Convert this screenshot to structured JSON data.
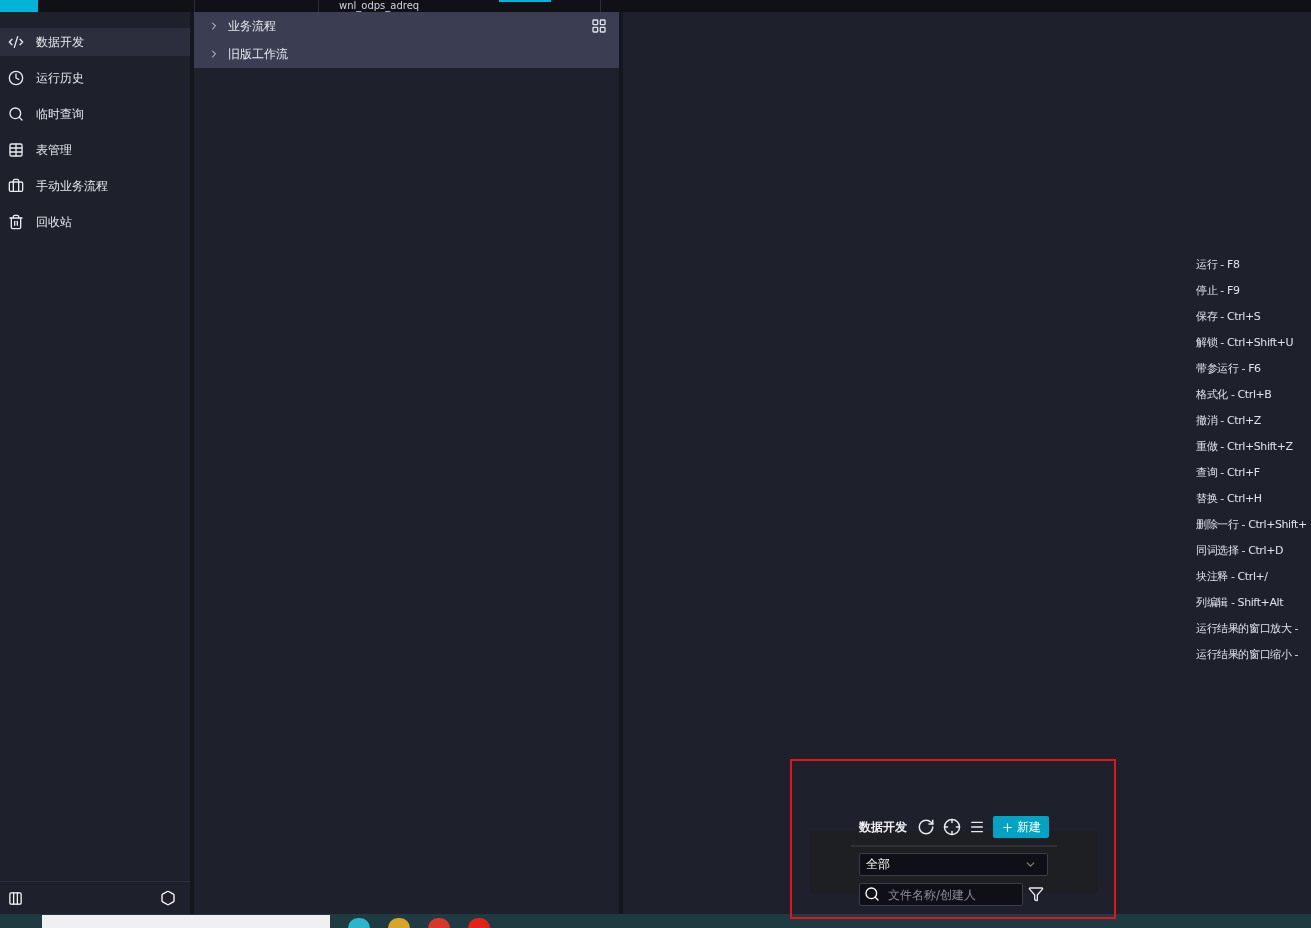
{
  "top_bar": {
    "tab": "wnl_odps_adreq"
  },
  "sidebar": {
    "items": [
      {
        "label": "数据开发",
        "selected": true
      },
      {
        "label": "运行历史",
        "selected": false
      },
      {
        "label": "临时查询",
        "selected": false
      },
      {
        "label": "表管理",
        "selected": false
      },
      {
        "label": "手动业务流程",
        "selected": false
      },
      {
        "label": "回收站",
        "selected": false
      }
    ]
  },
  "tree": {
    "items": [
      {
        "label": "业务流程",
        "expanded": false
      },
      {
        "label": "旧版工作流",
        "expanded": false
      }
    ]
  },
  "shortcuts": [
    "运行 - F8",
    "停止 - F9",
    "保存 - Ctrl+S",
    "解锁 - Ctrl+Shift+U",
    "带参运行 - F6",
    "格式化 - Ctrl+B",
    "撤消 - Ctrl+Z",
    "重做 - Ctrl+Shift+Z",
    "查询 - Ctrl+F",
    "替换 - Ctrl+H",
    "删除一行 - Ctrl+Shift+",
    "同词选择 - Ctrl+D",
    "块注释 - Ctrl+/",
    "列编辑 - Shift+Alt",
    "运行结果的窗口放大 -",
    "运行结果的窗口缩小 -"
  ],
  "popup": {
    "title": "数据开发",
    "new_button": "新建",
    "filter_select": "全部",
    "search": {
      "placeholder": "文件名称/创建人"
    }
  }
}
